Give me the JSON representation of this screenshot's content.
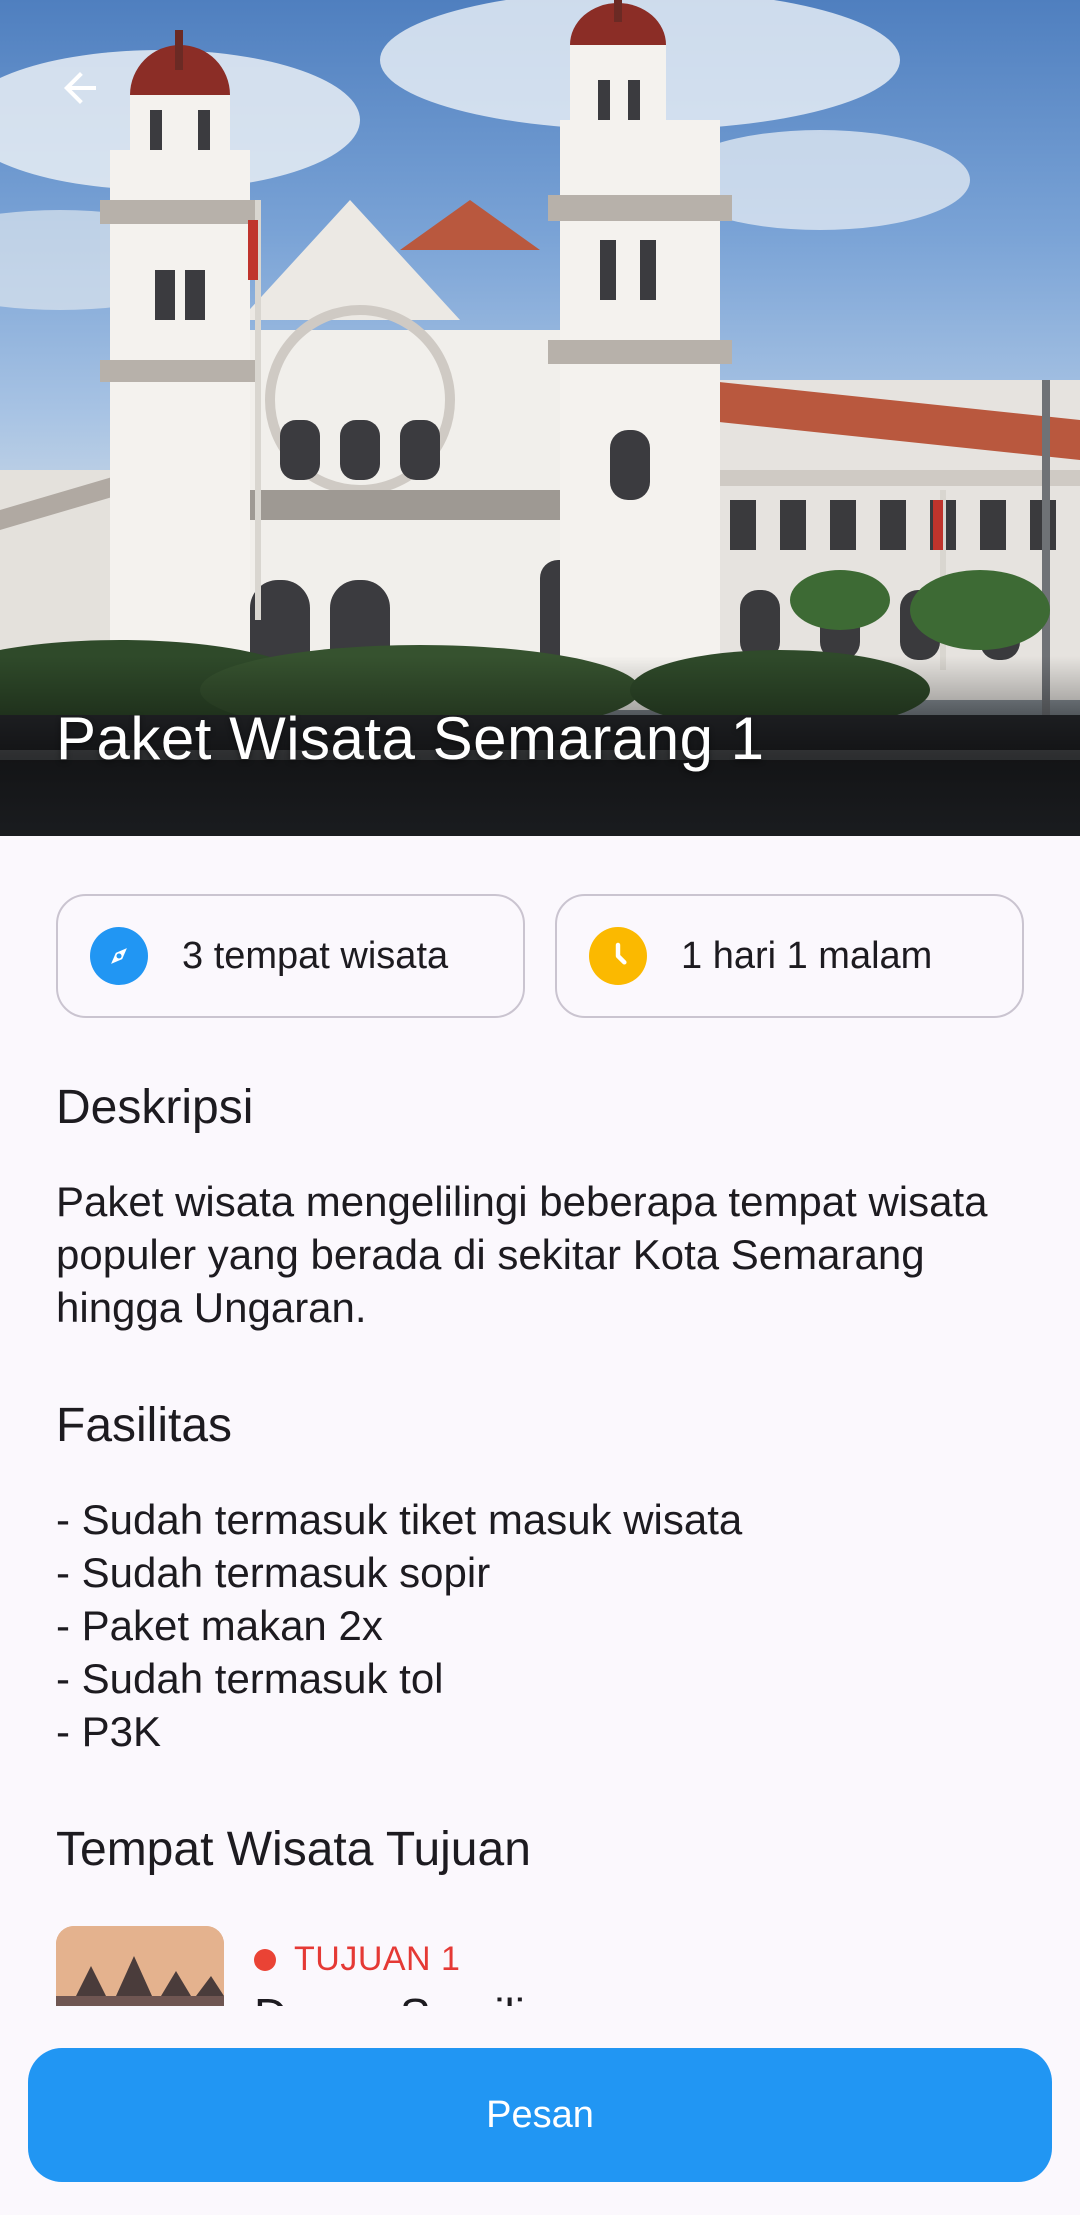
{
  "header": {
    "title": "Paket Wisata Semarang 1",
    "back_icon": "arrow-back-icon"
  },
  "info": {
    "places": {
      "icon": "compass-icon",
      "label": "3 tempat wisata",
      "color": "#2196f3"
    },
    "duration": {
      "icon": "clock-icon",
      "label": "1 hari 1 malam",
      "color": "#fbb900"
    }
  },
  "description": {
    "title": "Deskripsi",
    "text": "Paket wisata mengelilingi beberapa tempat wisata populer yang berada di sekitar Kota Semarang hingga Ungaran."
  },
  "facilities": {
    "title": "Fasilitas",
    "items": [
      "- Sudah termasuk tiket masuk wisata",
      "- Sudah termasuk sopir",
      "- Paket makan 2x",
      "- Sudah termasuk tol",
      "- P3K"
    ]
  },
  "destinations": {
    "title": "Tempat Wisata Tujuan",
    "items": [
      {
        "tag": "TUJUAN 1",
        "name": "Dusun Semilir",
        "dot_color": "#ea4335"
      }
    ]
  },
  "footer": {
    "order_label": "Pesan",
    "button_color": "#2196f3"
  }
}
